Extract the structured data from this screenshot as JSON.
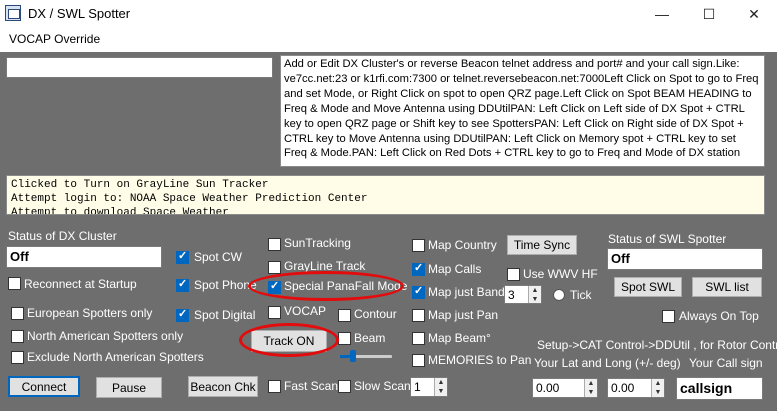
{
  "window": {
    "title": "DX / SWL Spotter",
    "min": "—",
    "max": "☐",
    "close": "✕"
  },
  "menu": {
    "vocap": "VOCAP Override"
  },
  "help_text": "Add or Edit DX Cluster's or reverse Beacon telnet address and port# and your call sign.Like: ve7cc.net:23 or k1rfi.com:7300 or telnet.reversebeacon.net:7000Left Click on Spot to go to Freq and set Mode, or Right Click on spot to open QRZ page.Left Click on Spot BEAM HEADING to Freq & Mode and Move Antenna using DDUtilPAN: Left Click on Left side of DX Spot + CTRL key to open QRZ page or Shift key to see SpottersPAN: Left Click on Right side of DX Spot + CTRL key to Move Antenna using DDUtilPAN: Left Click on Memory spot + CTRL key  to set Freq & Mode.PAN: Left Click on Red Dots  + CTRL key to go to Freq and Mode of DX station",
  "log": {
    "line1": "Clicked to Turn on GrayLine Sun Tracker",
    "line2": "Attempt login to:  NOAA Space Weather Prediction Center",
    "line3": "Attempt to download Space Weather"
  },
  "dx_status": {
    "label": "Status of DX Cluster",
    "value": "Off"
  },
  "swl_status": {
    "label": "Status of SWL Spotter",
    "value": "Off"
  },
  "checks": {
    "spot_cw": {
      "label": "Spot CW",
      "checked": true
    },
    "spot_phone": {
      "label": "Spot Phone",
      "checked": true
    },
    "spot_digital": {
      "label": "Spot Digital",
      "checked": true
    },
    "reconnect": {
      "label": "Reconnect at Startup",
      "checked": false
    },
    "european": {
      "label": "European Spotters only",
      "checked": false
    },
    "north_american": {
      "label": "North American Spotters only",
      "checked": false
    },
    "exclude_na": {
      "label": "Exclude North American Spotters",
      "checked": false
    },
    "sun_tracking": {
      "label": "SunTracking",
      "checked": false
    },
    "grayline": {
      "label": "GrayLine Track",
      "checked": false
    },
    "panafall": {
      "label": "Special PanaFall Mode",
      "checked": true
    },
    "vocap": {
      "label": "VOCAP",
      "checked": false
    },
    "contour": {
      "label": "Contour",
      "checked": false
    },
    "beam": {
      "label": "Beam",
      "checked": false
    },
    "map_country": {
      "label": "Map Country",
      "checked": false
    },
    "map_calls": {
      "label": "Map Calls",
      "checked": true
    },
    "map_just_band": {
      "label": "Map just Band",
      "checked": true
    },
    "map_just_pan": {
      "label": "Map just Pan",
      "checked": false
    },
    "map_beam": {
      "label": "Map Beam°",
      "checked": false
    },
    "memories": {
      "label": "MEMORIES to Pan",
      "checked": false
    },
    "use_wwv": {
      "label": "Use WWV HF",
      "checked": false
    },
    "always_on_top": {
      "label": "Always On Top",
      "checked": false
    },
    "fast_scan": {
      "label": "Fast Scan",
      "checked": false
    },
    "slow_scan": {
      "label": "Slow Scan",
      "checked": false
    }
  },
  "buttons": {
    "time_sync": "Time Sync",
    "spot_swl": "Spot SWL",
    "swl_list": "SWL list",
    "track_on": "Track ON",
    "connect": "Connect",
    "pause": "Pause",
    "beacon_chk": "Beacon Chk"
  },
  "tick": {
    "label": "Tick",
    "value": "3"
  },
  "slow_scan_value": "1",
  "cat_label": "Setup->CAT Control->DDUtil , for Rotor Control",
  "latlong_label": "Your Lat and Long (+/- deg)",
  "callsign_label": "Your Call sign",
  "lat": "0.00",
  "long": "0.00",
  "callsign": "callsign",
  "accent": "#0067c0",
  "annotation_color": "#e30b0b"
}
